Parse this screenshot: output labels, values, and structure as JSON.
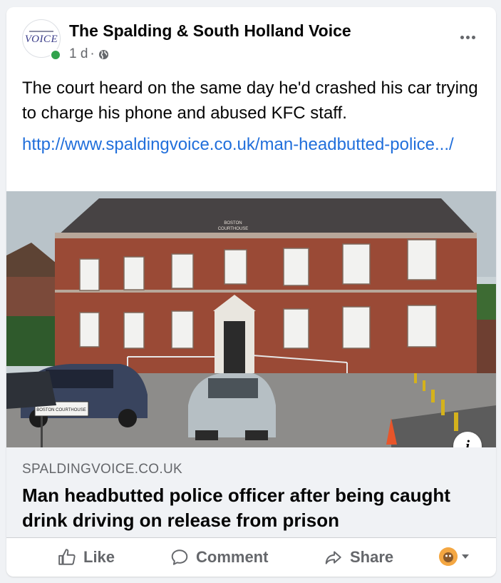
{
  "post": {
    "page_name": "The Spalding & South Holland Voice",
    "avatar_text": "VOICE",
    "time": "1 d",
    "separator": "·",
    "audience_icon": "globe-icon",
    "text": "The court heard on the same day he'd crashed his car trying to charge his phone and abused KFC staff.",
    "link": "http://www.spaldingvoice.co.uk/man-headbutted-police.../"
  },
  "photo": {
    "sign_line1": "BOSTON",
    "sign_line2": "COURTHOUSE",
    "street_sign": "BOSTON COURTHOUSE",
    "info_label": "i"
  },
  "preview": {
    "domain": "SPALDINGVOICE.CO.UK",
    "headline": "Man headbutted police officer after being caught drink driving on release from prison"
  },
  "actions": {
    "like": "Like",
    "comment": "Comment",
    "share": "Share"
  },
  "colors": {
    "link": "#216fdb",
    "online": "#31a24c",
    "secondary_text": "#65676b",
    "brick": "#9a4a36"
  }
}
